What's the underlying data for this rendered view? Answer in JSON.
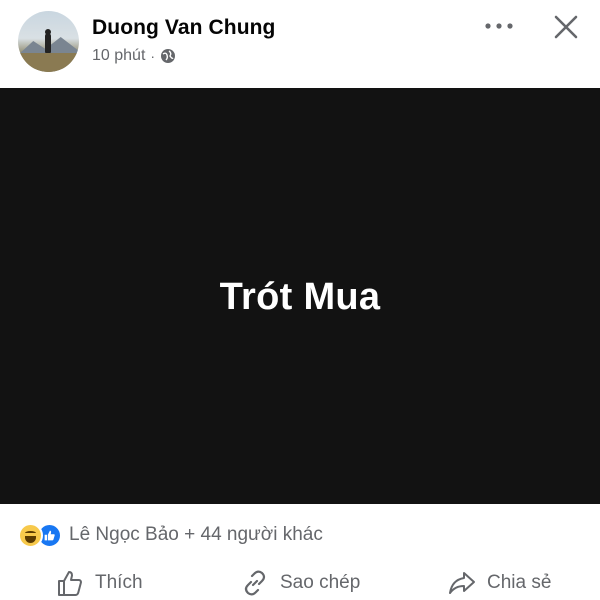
{
  "post": {
    "author_name": "Duong Van Chung",
    "time": "10 phút",
    "separator": "·",
    "privacy_icon": "globe-icon",
    "media_text": "Trót Mua"
  },
  "header": {
    "more_icon": "more-horizontal-icon",
    "close_icon": "close-icon"
  },
  "reactions": {
    "icons": [
      "haha-reaction-icon",
      "like-reaction-icon"
    ],
    "summary": "Lê Ngọc Bảo + 44 người khác"
  },
  "actions": {
    "like_label": "Thích",
    "copy_label": "Sao chép",
    "share_label": "Chia sẻ"
  },
  "colors": {
    "media_background": "#121212",
    "secondary_text": "#65676b",
    "like_blue": "#1877f2",
    "haha_yellow": "#f7c94b"
  }
}
